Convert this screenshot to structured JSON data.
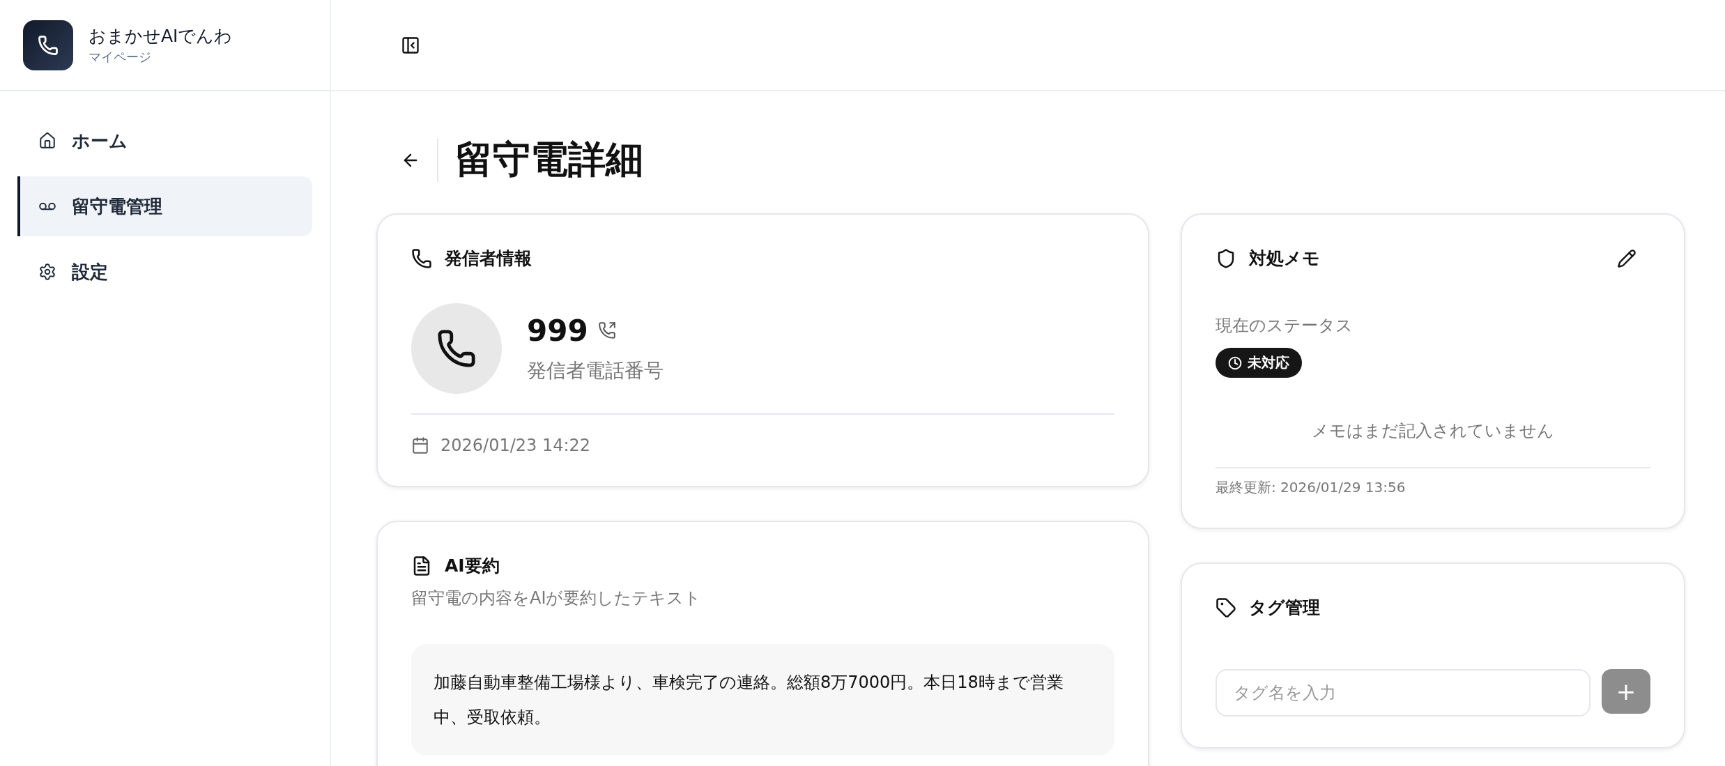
{
  "app": {
    "name": "おまかせAIでんわ",
    "subtitle": "マイページ"
  },
  "nav": [
    {
      "label": "ホーム",
      "selected": false
    },
    {
      "label": "留守電管理",
      "selected": true
    },
    {
      "label": "設定",
      "selected": false
    }
  ],
  "page": {
    "title": "留守電詳細"
  },
  "caller_card": {
    "title": "発信者情報",
    "number": "999",
    "number_label": "発信者電話番号",
    "datetime": "2026/01/23 14:22"
  },
  "summary_card": {
    "title": "AI要約",
    "subtitle": "留守電の内容をAIが要約したテキスト",
    "text": "加藤自動車整備工場様より、車検完了の連絡。総額8万7000円。本日18時まで営業中、受取依頼。"
  },
  "memo_card": {
    "title": "対処メモ",
    "status_label": "現在のステータス",
    "status": "未対応",
    "empty_text": "メモはまだ記入されていません",
    "last_updated": "最終更新: 2026/01/29 13:56"
  },
  "tag_card": {
    "title": "タグ管理",
    "input": {
      "placeholder": "タグ名を入力"
    },
    "add_button": "+"
  }
}
